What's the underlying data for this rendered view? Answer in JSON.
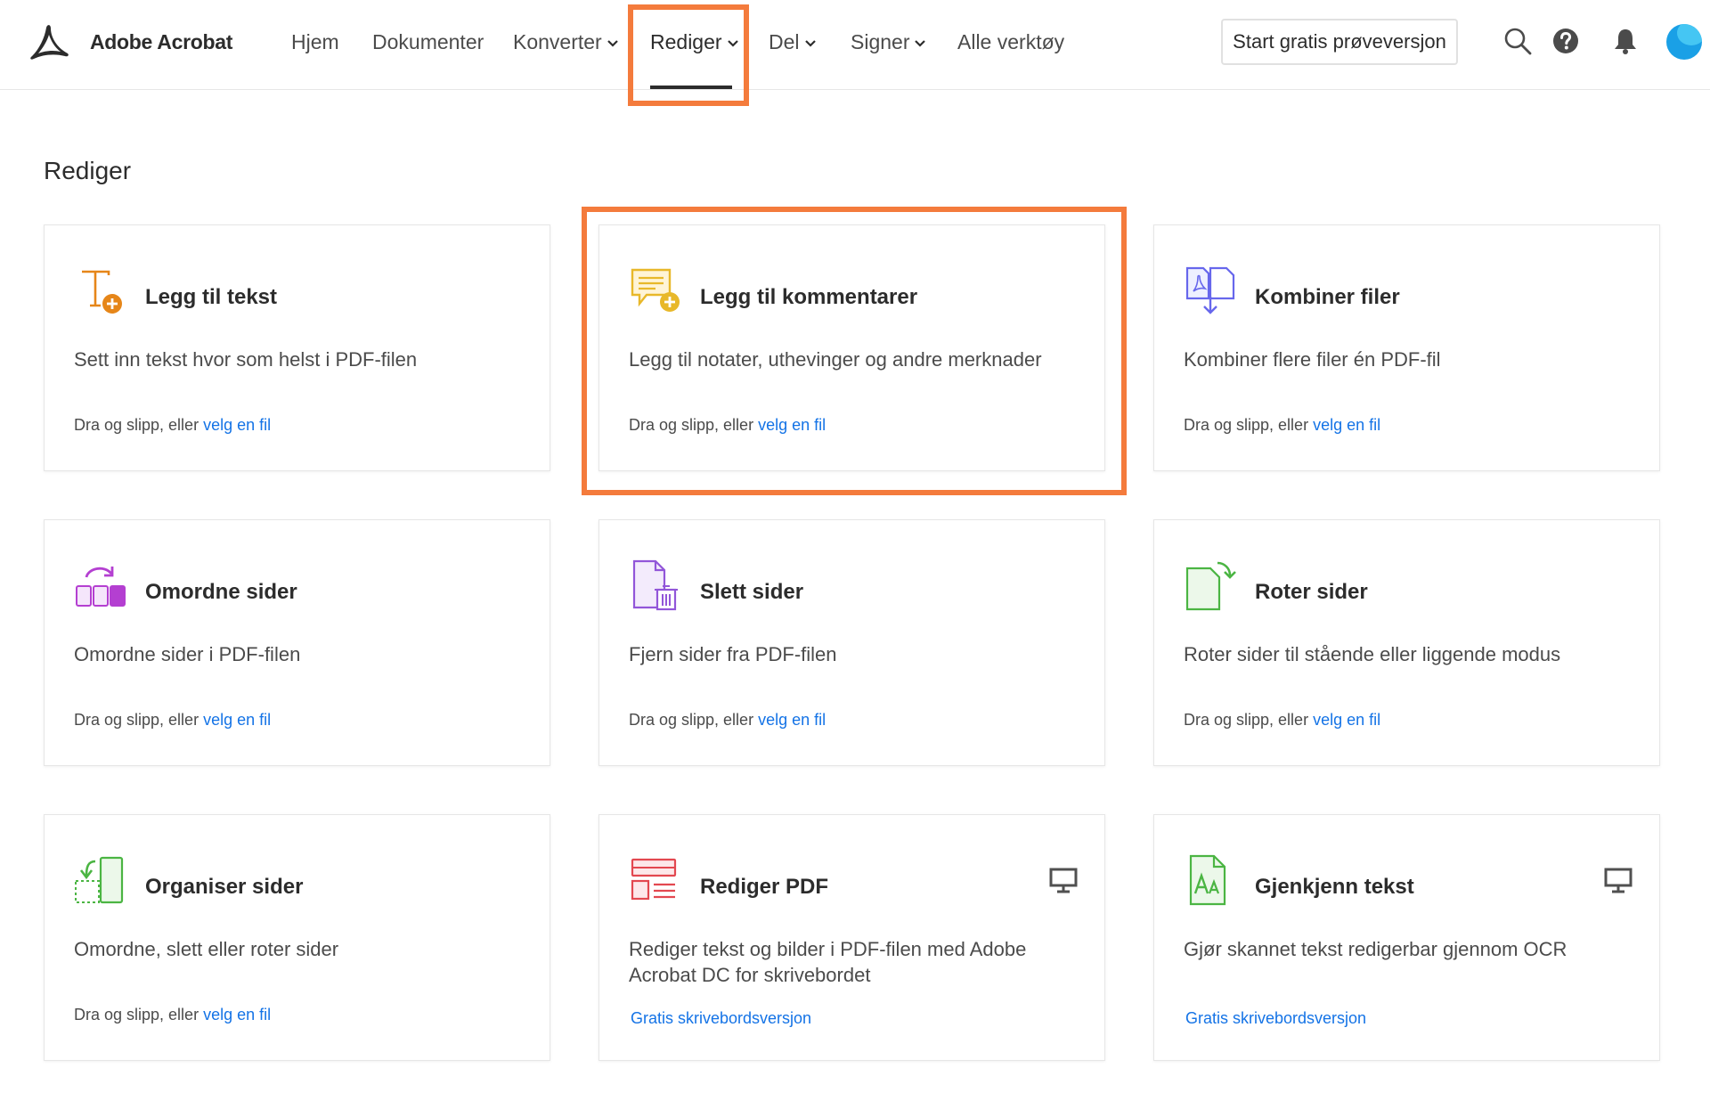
{
  "header": {
    "app_name": "Adobe Acrobat",
    "nav": [
      {
        "label": "Hjem",
        "dropdown": false
      },
      {
        "label": "Dokumenter",
        "dropdown": false
      },
      {
        "label": "Konverter",
        "dropdown": true
      },
      {
        "label": "Rediger",
        "dropdown": true,
        "active": true
      },
      {
        "label": "Del",
        "dropdown": true
      },
      {
        "label": "Signer",
        "dropdown": true
      },
      {
        "label": "Alle verktøy",
        "dropdown": false
      }
    ],
    "trial_button": "Start gratis prøveversjon",
    "icons": [
      "search-icon",
      "help-icon",
      "bell-icon",
      "avatar"
    ]
  },
  "page": {
    "title": "Rediger",
    "drop_text": "Dra og slipp, eller",
    "choose_file": "velg en fil"
  },
  "cards": [
    {
      "title": "Legg til tekst",
      "description": "Sett inn tekst hvor som helst i PDF-filen",
      "icon": "add-text-icon",
      "color": "#e68619"
    },
    {
      "title": "Legg til kommentarer",
      "description": "Legg til notater, uthevinger og andre merknader",
      "icon": "add-comment-icon",
      "color": "#e8c23a",
      "highlighted": true
    },
    {
      "title": "Kombiner filer",
      "description": "Kombiner flere filer én PDF-fil",
      "icon": "combine-files-icon",
      "color": "#6767ec"
    },
    {
      "title": "Omordne sider",
      "description": "Omordne sider i PDF-filen",
      "icon": "reorder-pages-icon",
      "color": "#b43fd1"
    },
    {
      "title": "Slett sider",
      "description": "Fjern sider fra PDF-filen",
      "icon": "delete-pages-icon",
      "color": "#9256d9"
    },
    {
      "title": "Roter sider",
      "description": "Roter sider til stående eller liggende modus",
      "icon": "rotate-pages-icon",
      "color": "#4bb543"
    },
    {
      "title": "Organiser sider",
      "description": "Omordne, slett eller roter sider",
      "icon": "organize-pages-icon",
      "color": "#4bb543"
    },
    {
      "title": "Rediger PDF",
      "description": "Rediger tekst og bilder i PDF-filen med Adobe Acrobat DC for skrivebordet",
      "icon": "edit-pdf-icon",
      "color": "#e34850",
      "link": "Gratis skrivebordsversjon",
      "desktop": true
    },
    {
      "title": "Gjenkjenn tekst",
      "description": "Gjør skannet tekst redigerbar gjennom OCR",
      "icon": "recognize-text-icon",
      "color": "#4bb543",
      "link": "Gratis skrivebordsversjon",
      "desktop": true
    }
  ],
  "colors": {
    "highlight": "#f47b3c",
    "link": "#1473e6"
  }
}
